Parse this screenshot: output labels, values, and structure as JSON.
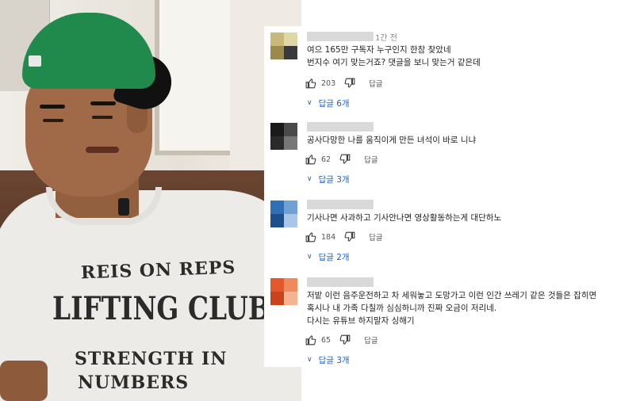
{
  "photo": {
    "shirt_print": [
      "REIS ON REPS",
      "LIFTING CLUB",
      "STRENGTH IN",
      "NUMBERS"
    ]
  },
  "comments": [
    {
      "time": "1간 전",
      "lines": [
        "여으 165만 구독자 누구인지 한참 찾았네",
        "번지수 여기 맞는거죠? 댓글을 보니 맞는거 같은데"
      ],
      "likes": "203",
      "reply_label": "답글",
      "replies_label": "답글 6개",
      "avatar_colors": [
        "#c8b87a",
        "#e0d6a6",
        "#9c8a4a",
        "#3a3a3a"
      ]
    },
    {
      "time": "",
      "lines": [
        "공사다망한 나를 움직이게 만든 녀석이 바로 니냐"
      ],
      "likes": "62",
      "reply_label": "답글",
      "replies_label": "답글 3개",
      "avatar_colors": [
        "#1a1a1a",
        "#4a4a4a",
        "#2a2a2a",
        "#777777"
      ]
    },
    {
      "time": "",
      "lines": [
        "기사나면 사과하고 기사안나면 영상활동하는게 대단하노"
      ],
      "likes": "184",
      "reply_label": "답글",
      "replies_label": "답글 2개",
      "avatar_colors": [
        "#2f6fb5",
        "#6fa0d6",
        "#1d4f8c",
        "#a9c6e8"
      ]
    },
    {
      "time": "",
      "lines": [
        "저밭 이런 음주운전하고 차 세워놓고 도망가고 이런 인간 쓰레기 같은 것들은 잡히면",
        "혹시나 내 가족 다칠까 심심하니까 진짜 오금이 저리네.",
        "다시는 유튜브 하지말자 싱해기"
      ],
      "likes": "65",
      "reply_label": "답글",
      "replies_label": "답글 3개",
      "avatar_colors": [
        "#e2582c",
        "#f08a5d",
        "#c9441c",
        "#f6b394"
      ]
    }
  ],
  "icons": {
    "like": "thumbs-up-icon",
    "dislike": "thumbs-down-icon",
    "expand": "chevron-down-icon"
  },
  "colors": {
    "link": "#1a5fc9",
    "cap": "#1f8a4c"
  }
}
